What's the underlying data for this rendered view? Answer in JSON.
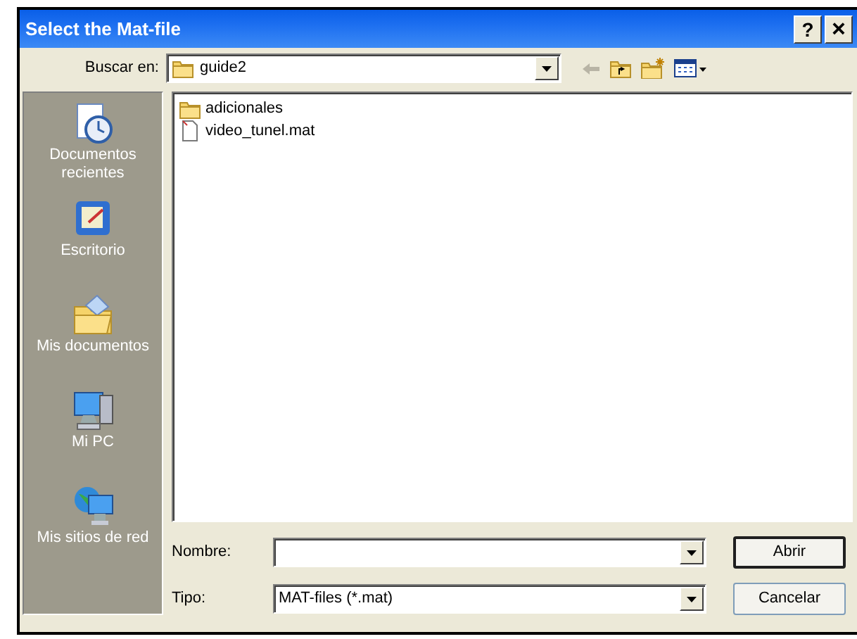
{
  "window": {
    "title": "Select the Mat-file",
    "controls": [
      {
        "kind": "help",
        "label": "?"
      },
      {
        "kind": "close",
        "label": "×"
      }
    ]
  },
  "look_in": {
    "label": "Buscar en:",
    "value": "guide2"
  },
  "toolbar": [
    {
      "kind": "back",
      "disabled": true
    },
    {
      "kind": "up",
      "disabled": false
    },
    {
      "kind": "new_folder",
      "disabled": false
    },
    {
      "kind": "views",
      "disabled": false
    }
  ],
  "places": [
    {
      "kind": "recent",
      "label": "Documentos recientes"
    },
    {
      "kind": "desktop",
      "label": "Escritorio"
    },
    {
      "kind": "documents",
      "label": "Mis documentos"
    },
    {
      "kind": "computer",
      "label": "Mi PC"
    },
    {
      "kind": "network",
      "label": "Mis sitios de red"
    }
  ],
  "files": [
    {
      "kind": "folder",
      "name": "adicionales",
      "selected": false
    },
    {
      "kind": "file",
      "name": "video_tunel.mat",
      "selected": false
    }
  ],
  "file_name": {
    "label": "Nombre:"
  },
  "file_type": {
    "label": "Tipo:",
    "value": "MAT-files (*.mat)"
  },
  "buttons": [
    {
      "label": "Abrir",
      "default": true
    },
    {
      "label": "Cancelar",
      "default": false
    }
  ]
}
